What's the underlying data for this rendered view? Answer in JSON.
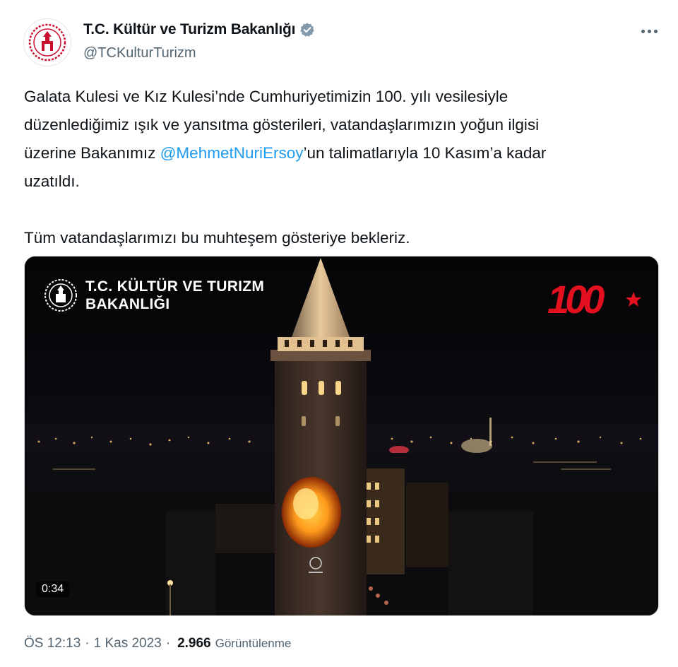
{
  "account": {
    "display_name": "T.C. Kültür ve Turizm Bakanlığı",
    "handle": "@TCKulturTurizm",
    "avatar_icon": "ministry-seal-icon",
    "verified_icon": "verified-badge-icon"
  },
  "tweet": {
    "line1": "Galata Kulesi ve Kız Kulesi’nde Cumhuriyetimizin 100. yılı vesilesiyle",
    "line2": "düzenlediğimiz ışık ve yansıtma gösterileri, vatandaşlarımızın yoğun ilgisi",
    "line3_prefix": "üzerine Bakanımız ",
    "mention": "@MehmetNuriErsoy",
    "line3_suffix": "’un talimatlarıyla 10 Kasım’a kadar",
    "line4": "uzatıldı.",
    "line5": "Tüm vatandaşlarımızı bu muhteşem gösteriye bekleriz."
  },
  "media": {
    "overlay_line1": "T.C. KÜLTÜR VE TURIZM",
    "overlay_line2": "BAKANLIĞI",
    "badge_text": "100",
    "duration": "0:34",
    "accent_red": "#e3101f"
  },
  "meta": {
    "time": "ÖS 12:13",
    "date": "1 Kas 2023",
    "views_count": "2.966",
    "views_label": "Görüntülenme",
    "separator": "·"
  },
  "colors": {
    "text": "#0f1419",
    "secondary": "#536471",
    "link": "#1d9bf0",
    "verified": "#829aab"
  }
}
